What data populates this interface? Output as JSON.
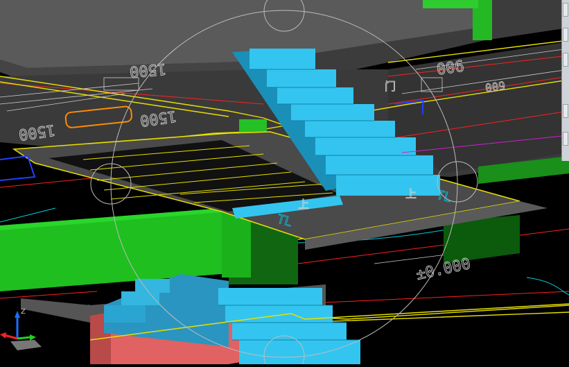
{
  "app": {
    "view_mode": "3D Orbit",
    "viewcube_label": ""
  },
  "drawing_labels": {
    "dim_1500_a": "1500",
    "dim_1500_b": "1500",
    "dim_1500_c": "1500",
    "dim_006_a": "006",
    "dim_009": "009",
    "elev_0000": "±0.000",
    "up_arrow_top": "上",
    "up_arrow_bottom": "上",
    "mark_a": "TL",
    "mark_b": "TL",
    "room_mark": "门"
  },
  "colors": {
    "background": "#000000",
    "slab_gray": "#555555",
    "stair_blue": "#33c5ef",
    "wall_green": "#1fbf1f",
    "wall_red": "#e06060",
    "line_yellow": "#e8e000",
    "line_red": "#ff2020",
    "line_cyan": "#00d0e0",
    "line_white": "#cfcfcf",
    "orbit_ring": "#bdbdbd"
  },
  "ucs_icon": {
    "x_axis": "X",
    "y_axis": "Y",
    "z_axis": "Z"
  },
  "toolstrip": {
    "buttons": [
      "viewcube-icon",
      "pan-icon",
      "zoom-icon",
      "orbit-icon",
      "wheel-icon"
    ]
  }
}
